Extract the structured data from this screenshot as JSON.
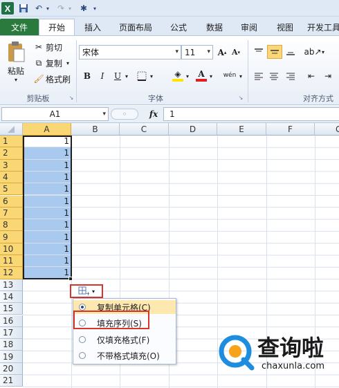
{
  "qat": {
    "logo": "X"
  },
  "tabs": [
    "文件",
    "开始",
    "插入",
    "页面布局",
    "公式",
    "数据",
    "审阅",
    "视图",
    "开发工具"
  ],
  "ribbon": {
    "clipboard": {
      "paste": "粘贴",
      "cut": "剪切",
      "copy": "复制",
      "format_painter": "格式刷",
      "group": "剪贴板"
    },
    "font": {
      "name": "宋体",
      "size": "11",
      "group": "字体"
    },
    "align": {
      "group": "对齐方式"
    }
  },
  "formula_bar": {
    "name_box": "A1",
    "fx": "fx",
    "value": "1"
  },
  "columns": [
    "A",
    "B",
    "C",
    "D",
    "E",
    "F",
    "G"
  ],
  "rows": [
    "1",
    "2",
    "3",
    "4",
    "5",
    "6",
    "7",
    "8",
    "9",
    "10",
    "11",
    "12",
    "13",
    "14",
    "15",
    "16",
    "17",
    "18",
    "19",
    "20",
    "21"
  ],
  "cells_A": [
    "1",
    "1",
    "1",
    "1",
    "1",
    "1",
    "1",
    "1",
    "1",
    "1",
    "1",
    "1"
  ],
  "autofill": {
    "options": [
      "复制单元格(C)",
      "填充序列(S)",
      "仅填充格式(F)",
      "不带格式填充(O)"
    ],
    "selected_index": 0
  },
  "watermark": {
    "brand": "查询啦",
    "url": "chaxunla.com"
  },
  "colors": {
    "selection": "#a9c9ee",
    "header_selected": "#f9d774",
    "highlight_box": "#d9342b",
    "file_tab": "#2a7a3d"
  }
}
